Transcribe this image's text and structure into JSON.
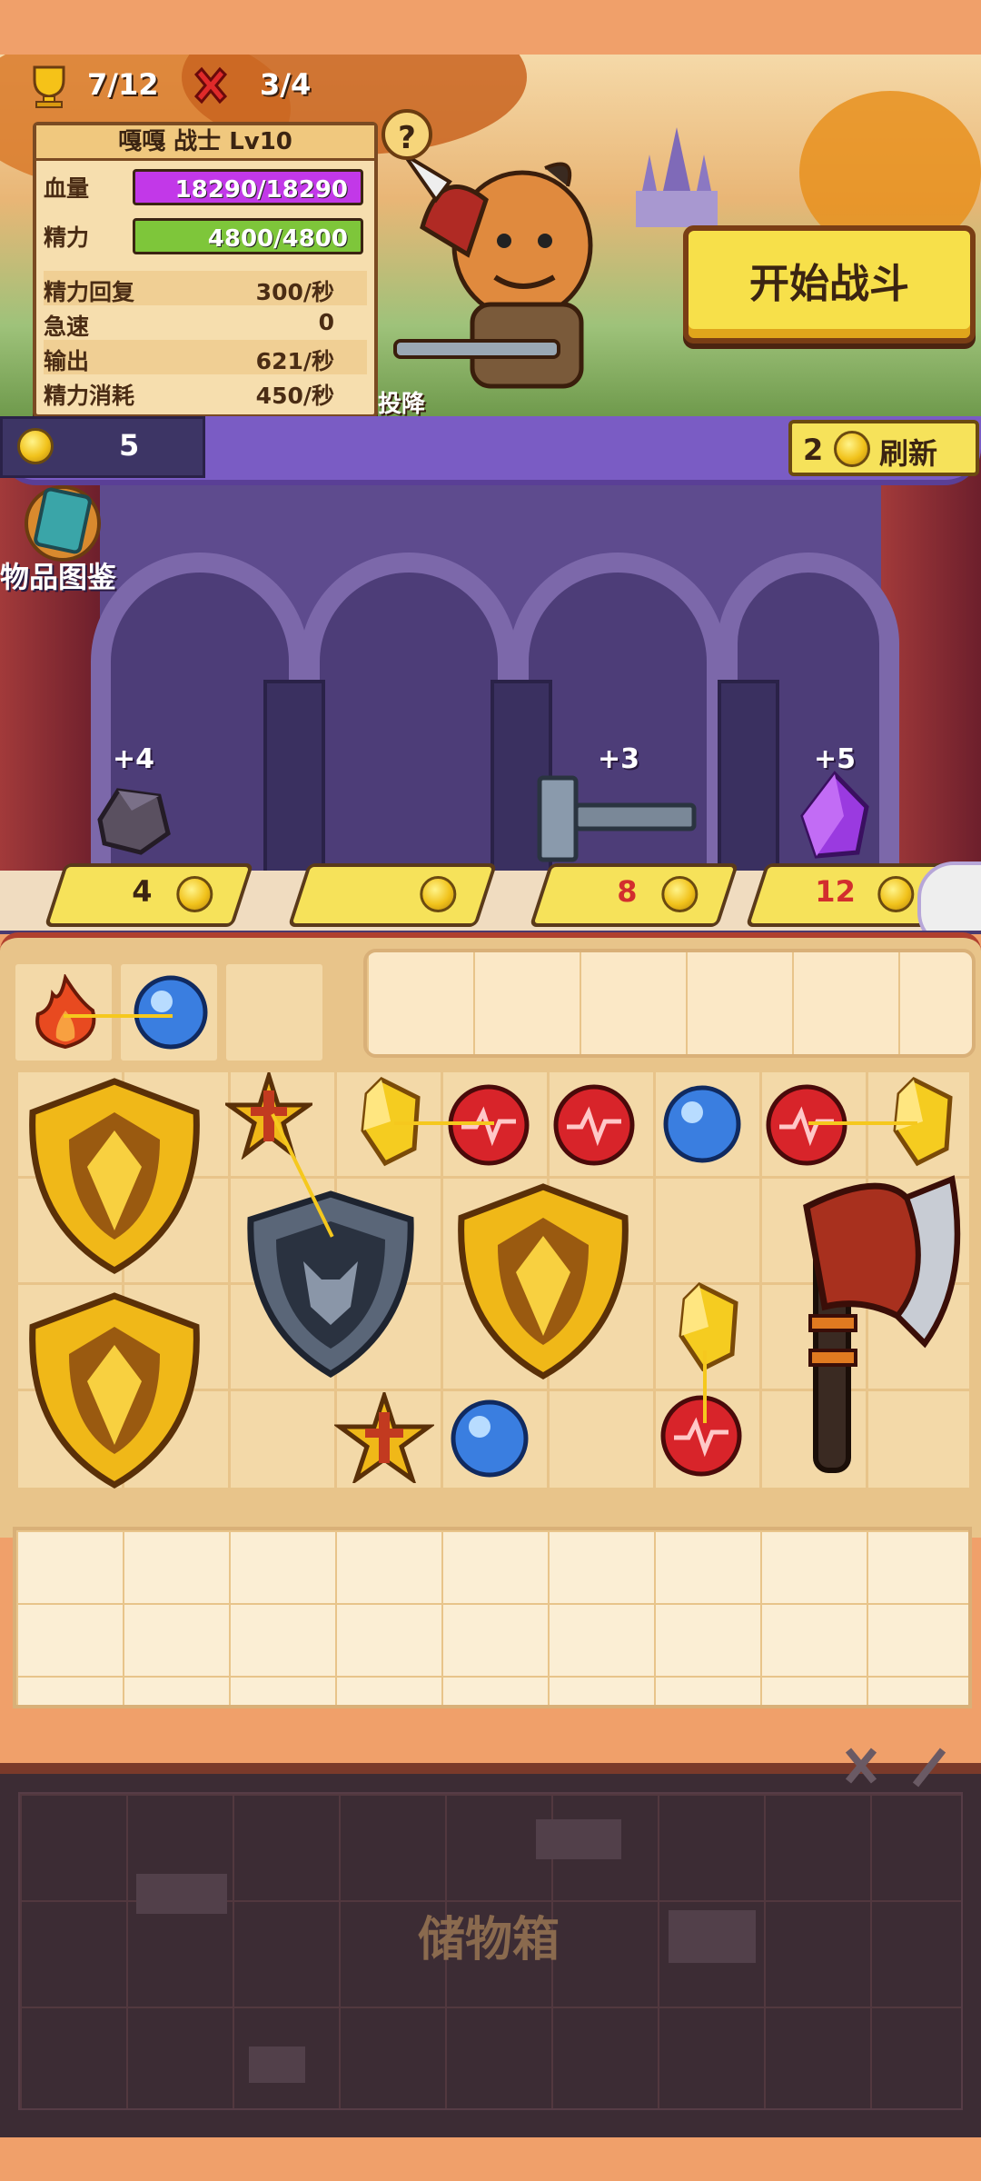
{
  "header": {
    "trophies": "7/12",
    "losses": "3/4",
    "help": "?",
    "character": {
      "title": "嘎嘎 战士 Lv10",
      "hp_label": "血量",
      "hp_value": "18290/18290",
      "hp_fraction": 1.0,
      "energy_label": "精力",
      "energy_value": "4800/4800",
      "energy_fraction": 1.0,
      "stats": [
        {
          "label": "精力回复",
          "value": "300/秒"
        },
        {
          "label": "急速",
          "value": "0"
        },
        {
          "label": "输出",
          "value": "621/秒"
        },
        {
          "label": "精力消耗",
          "value": "450/秒"
        }
      ]
    },
    "surrender": "投降",
    "start_battle": "开始战斗",
    "colors": {
      "hp": "#c238e8",
      "energy": "#7ec63a",
      "button": "#f7e04a"
    }
  },
  "shop": {
    "gold": "5",
    "refresh_cost": "2",
    "refresh_label": "刷新",
    "catalog_label": "物品图鉴",
    "items": [
      {
        "name": "stone",
        "bonus": "+4",
        "price": "4",
        "price_color": "#3b2412"
      },
      {
        "name": "empty",
        "bonus": "",
        "price": "",
        "price_color": "#3b2412"
      },
      {
        "name": "hammer",
        "bonus": "+3",
        "price": "8",
        "price_color": "#d22e2e"
      },
      {
        "name": "purple-crystal",
        "bonus": "+5",
        "price": "12",
        "price_color": "#d22e2e"
      }
    ]
  },
  "storage": {
    "label": "储物箱"
  }
}
